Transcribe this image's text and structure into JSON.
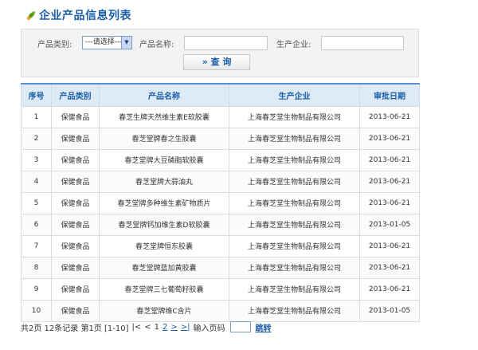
{
  "page": {
    "title": "企业产品信息列表"
  },
  "search": {
    "category_label": "产品类别:",
    "category_selected": "---请选择---",
    "name_label": "产品名称:",
    "name_value": "",
    "company_label": "生产企业:",
    "company_value": "",
    "query_button": "» 查 询"
  },
  "table": {
    "headers": [
      "序号",
      "产品类别",
      "产品名称",
      "生产企业",
      "审批日期"
    ],
    "rows": [
      [
        "1",
        "保健食品",
        "春芝生牌天然维生素E软胶囊",
        "上海春芝堂生物制品有限公司",
        "2013-06-21"
      ],
      [
        "2",
        "保健食品",
        "春芝堂牌春之生胶囊",
        "上海春芝堂生物制品有限公司",
        "2013-06-21"
      ],
      [
        "3",
        "保健食品",
        "春芝堂牌大豆磷脂软胶囊",
        "上海春芝堂生物制品有限公司",
        "2013-06-21"
      ],
      [
        "4",
        "保健食品",
        "春芝堂牌大蒜油丸",
        "上海春芝堂生物制品有限公司",
        "2013-06-21"
      ],
      [
        "5",
        "保健食品",
        "春芝堂牌多种维生素矿物质片",
        "上海春芝堂生物制品有限公司",
        "2013-06-21"
      ],
      [
        "6",
        "保健食品",
        "春芝堂牌钙加维生素D软胶囊",
        "上海春芝堂生物制品有限公司",
        "2013-01-05"
      ],
      [
        "7",
        "保健食品",
        "春芝堂牌恒东胶囊",
        "上海春芝堂生物制品有限公司",
        "2013-06-21"
      ],
      [
        "8",
        "保健食品",
        "春芝堂牌蓝加黄胶囊",
        "上海春芝堂生物制品有限公司",
        "2013-06-21"
      ],
      [
        "9",
        "保健食品",
        "春芝堂牌三七葡萄籽胶囊",
        "上海春芝堂生物制品有限公司",
        "2013-06-21"
      ],
      [
        "10",
        "保健食品",
        "春芝堂牌维C含片",
        "上海春芝堂生物制品有限公司",
        "2013-01-05"
      ]
    ]
  },
  "pager": {
    "summary": "共2页 12条记录 第1页 [1-10]",
    "first": "|<",
    "prev": "<",
    "page1": "1",
    "page2": "2",
    "next": ">",
    "last": ">|",
    "goto_label": "输入页码",
    "goto_value": "",
    "go_button": "跳转"
  },
  "colors": {
    "accent": "#1a5fa8",
    "header_bg": "#dfeaf7",
    "icon_leaf": "#6cae2d",
    "icon_gold": "#f0a020"
  },
  "icons": {
    "title_icon": "leaf-icon",
    "select_arrow": "chevron-down-icon"
  }
}
